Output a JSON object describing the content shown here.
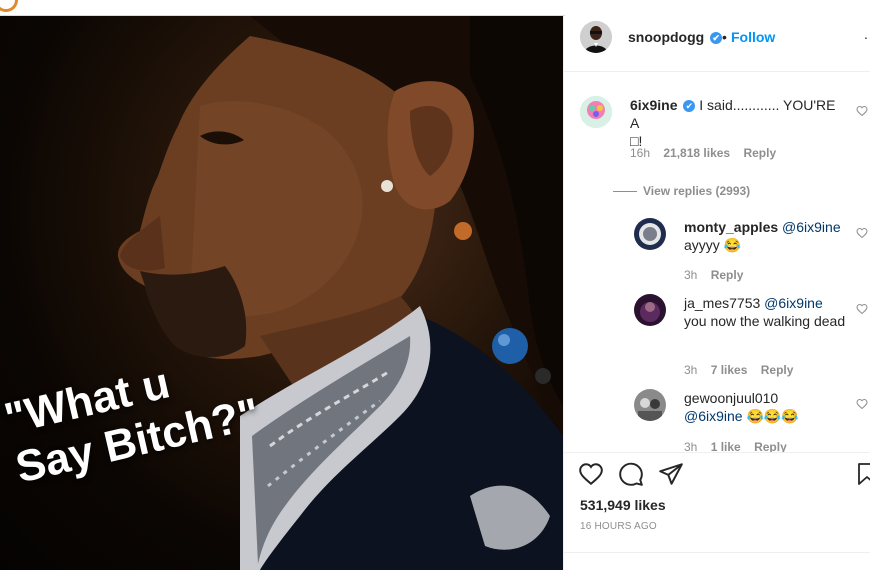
{
  "post": {
    "caption_line1": "\"What u",
    "caption_line2": "Say Bitch?\""
  },
  "header": {
    "username": "snoopdogg",
    "verified": "✔",
    "dot": "•",
    "follow": "Follow",
    "more": "..."
  },
  "comments": [
    {
      "username": "6ix9ine",
      "verified": "✔",
      "text": "I said............ YOU'RE A",
      "text2": "□!",
      "age": "16h",
      "likes": "21,818 likes",
      "reply": "Reply",
      "view_replies": "View replies (2993)"
    },
    {
      "username": "monty_apples",
      "mention": "@6ix9ine",
      "text": "ayyyy 😂",
      "age": "3h",
      "reply": "Reply"
    },
    {
      "username": "ja_mes7753",
      "mention": "@6ix9ine",
      "text": "you now the walking dead",
      "age": "3h",
      "likes": "7 likes",
      "reply": "Reply"
    },
    {
      "username": "gewoonjuul010",
      "mention": "@6ix9ine",
      "text": "😂😂😂",
      "age": "3h",
      "likes": "1 like",
      "reply": "Reply"
    }
  ],
  "actions": {
    "likes": "531,949 likes",
    "ago": "16 HOURS AGO"
  },
  "colors": {
    "accent_blue": "#0095f6",
    "verified_blue": "#3897f0",
    "muted": "#8e8e8e"
  },
  "icons": [
    "heart-icon",
    "comment-icon",
    "share-icon",
    "bookmark-icon",
    "verified-icon"
  ]
}
